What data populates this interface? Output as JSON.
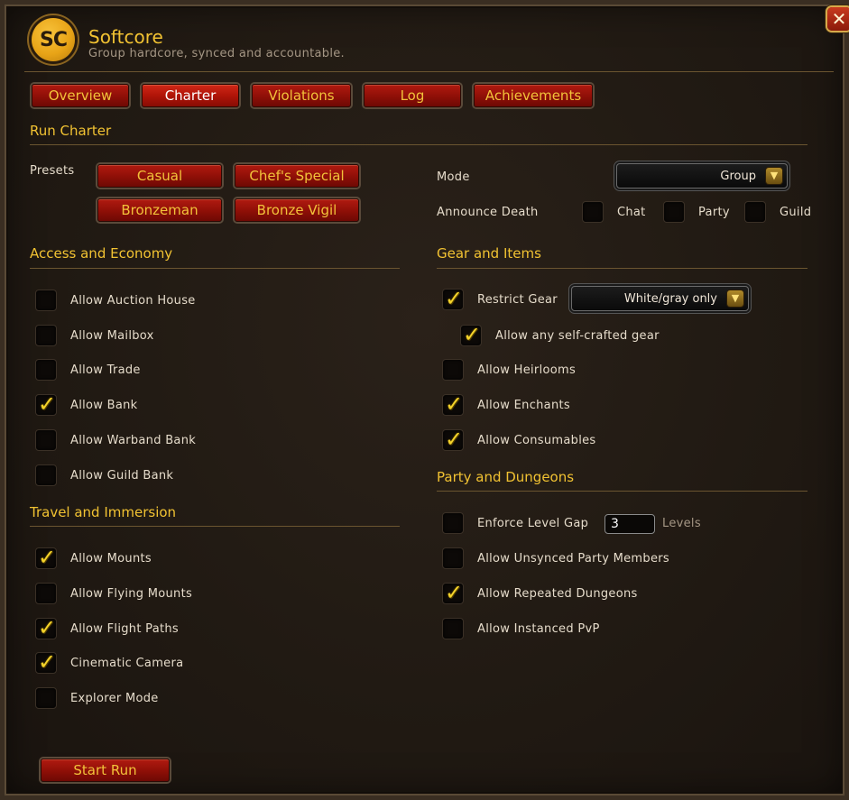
{
  "header": {
    "logo_text": "SC",
    "title": "Softcore",
    "subtitle": "Group hardcore, synced and accountable.",
    "close_label": "✕"
  },
  "tabs": [
    {
      "label": "Overview"
    },
    {
      "label": "Charter",
      "active": true
    },
    {
      "label": "Violations"
    },
    {
      "label": "Log"
    },
    {
      "label": "Achievements"
    }
  ],
  "run_charter": {
    "title": "Run Charter",
    "presets_label": "Presets",
    "presets": [
      "Casual",
      "Chef's Special",
      "Bronzeman",
      "Bronze Vigil"
    ],
    "mode_label": "Mode",
    "mode_value": "Group",
    "announce_label": "Announce Death",
    "announce_options": [
      {
        "label": "Chat",
        "checked": false
      },
      {
        "label": "Party",
        "checked": false
      },
      {
        "label": "Guild",
        "checked": false
      }
    ]
  },
  "access_economy": {
    "title": "Access and Economy",
    "items": [
      {
        "label": "Allow Auction House",
        "checked": false
      },
      {
        "label": "Allow Mailbox",
        "checked": false
      },
      {
        "label": "Allow Trade",
        "checked": false
      },
      {
        "label": "Allow Bank",
        "checked": true
      },
      {
        "label": "Allow Warband Bank",
        "checked": false
      },
      {
        "label": "Allow Guild Bank",
        "checked": false
      }
    ]
  },
  "travel_immersion": {
    "title": "Travel and Immersion",
    "items": [
      {
        "label": "Allow Mounts",
        "checked": true
      },
      {
        "label": "Allow Flying Mounts",
        "checked": false
      },
      {
        "label": "Allow Flight Paths",
        "checked": true
      },
      {
        "label": "Cinematic Camera",
        "checked": true
      },
      {
        "label": "Explorer Mode",
        "checked": false
      }
    ]
  },
  "gear_items": {
    "title": "Gear and Items",
    "restrict_gear": {
      "label": "Restrict Gear",
      "checked": true,
      "dropdown_value": "White/gray only"
    },
    "self_crafted": {
      "label": "Allow any self-crafted gear",
      "checked": true
    },
    "items": [
      {
        "label": "Allow Heirlooms",
        "checked": false
      },
      {
        "label": "Allow Enchants",
        "checked": true
      },
      {
        "label": "Allow Consumables",
        "checked": true
      }
    ]
  },
  "party_dungeons": {
    "title": "Party and Dungeons",
    "level_gap": {
      "label": "Enforce Level Gap",
      "checked": false,
      "value": "3",
      "unit": "Levels"
    },
    "items": [
      {
        "label": "Allow Unsynced Party Members",
        "checked": false
      },
      {
        "label": "Allow Repeated Dungeons",
        "checked": true
      },
      {
        "label": "Allow Instanced PvP",
        "checked": false
      }
    ]
  },
  "footer": {
    "start_label": "Start Run"
  },
  "colors": {
    "gold": "#f1c232",
    "red_button": "#8e0f07",
    "check": "#f3d22a"
  },
  "icons": {
    "check": "checkmark-icon",
    "close": "close-icon",
    "dropdown": "chevron-down-icon"
  }
}
